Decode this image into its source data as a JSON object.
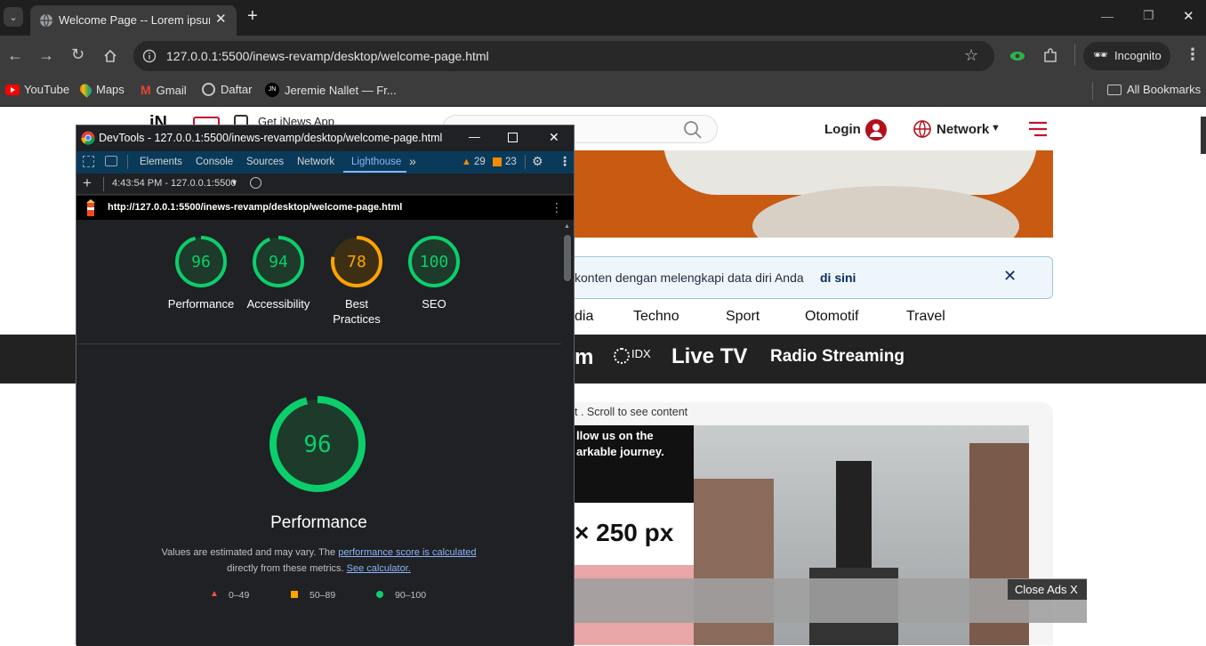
{
  "browser": {
    "tab_title": "Welcome Page -- Lorem ipsum",
    "url": "127.0.0.1:5500/inews-revamp/desktop/welcome-page.html",
    "profile_label": "Incognito",
    "bookmarks": [
      "YouTube",
      "Maps",
      "Gmail",
      "Daftar",
      "Jeremie Nallet — Fr..."
    ],
    "all_bookmarks": "All Bookmarks"
  },
  "site": {
    "get_app": "Get iNews App",
    "login": "Login",
    "network": "Network",
    "notice_text": "konten dengan melengkapi data diri Anda",
    "notice_link": "di sini",
    "nav": [
      "dia",
      "Techno",
      "Sport",
      "Otomotif",
      "Travel"
    ],
    "strip_items": [
      "m",
      "Live TV",
      "Radio Streaming"
    ],
    "idx_text": "IDX",
    "scroll_hint": "t . Scroll to see content",
    "ad_text_1": "llow us on the",
    "ad_text_2": "arkable journey.",
    "ad_size": "× 250 px",
    "close_ads": "Close Ads X"
  },
  "devtools": {
    "title": "DevTools - 127.0.0.1:5500/inews-revamp/desktop/welcome-page.html",
    "tabs": [
      "Elements",
      "Console",
      "Sources",
      "Network",
      "Lighthouse"
    ],
    "more_tabs": "»",
    "warnings": "29",
    "errors": "23",
    "session": "4:43:54 PM - 127.0.0.1:5500",
    "report_url": "http://127.0.0.1:5500/inews-revamp/desktop/welcome-page.html",
    "colors": {
      "pass": "#0cce6b",
      "average": "#ffa400",
      "fail": "#ff4e42"
    }
  },
  "lighthouse": {
    "scores": [
      {
        "label": "Performance",
        "value": 96,
        "rating": "pass"
      },
      {
        "label": "Accessibility",
        "value": 94,
        "rating": "pass"
      },
      {
        "label": "Best Practices",
        "value": 78,
        "rating": "average"
      },
      {
        "label": "SEO",
        "value": 100,
        "rating": "pass"
      }
    ],
    "main_score": 96,
    "main_title": "Performance",
    "description_prefix": "Values are estimated and may vary. The",
    "description_link": "performance score is calculated",
    "description_middle": "directly from these metrics.",
    "description_link2": "See calculator.",
    "legend": [
      {
        "shape": "triangle",
        "label": "0–49"
      },
      {
        "shape": "square",
        "label": "50–89"
      },
      {
        "shape": "circle",
        "label": "90–100"
      }
    ]
  }
}
